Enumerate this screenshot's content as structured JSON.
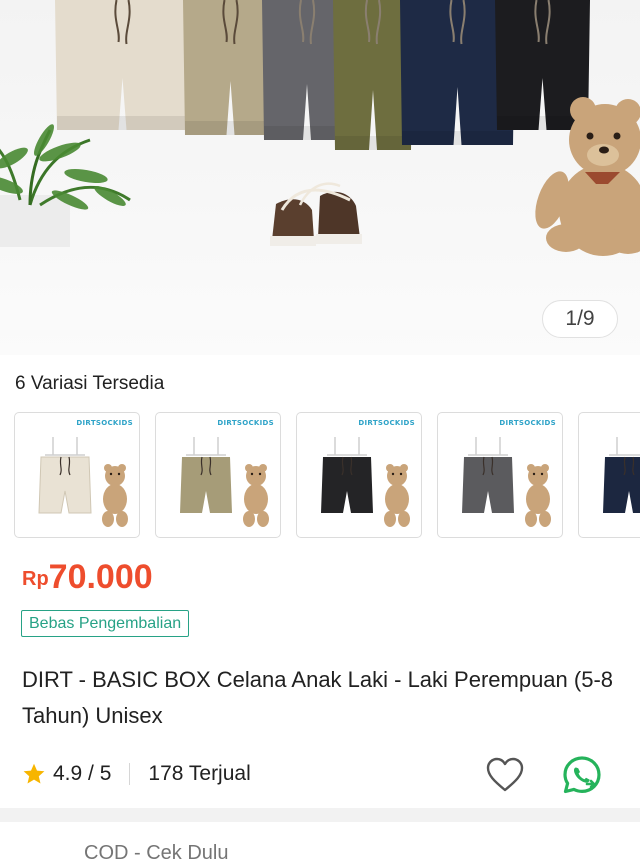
{
  "gallery": {
    "counter": "1/9",
    "colors": {
      "cream": "#e4dccd",
      "khaki": "#b5a98a",
      "charcoal": "#65656a",
      "olive": "#6e6e3f",
      "navy": "#1e2a45",
      "black": "#1c1c1f"
    },
    "decor_icons": [
      "plant-icon",
      "shoes-icon",
      "teddy-bear-icon"
    ]
  },
  "variants": {
    "title": "6 Variasi Tersedia",
    "brand_tag": "DIRTSOCKIDS",
    "items": [
      {
        "color": "#e9e2d4"
      },
      {
        "color": "#a69c78"
      },
      {
        "color": "#242426"
      },
      {
        "color": "#5b5b5e"
      },
      {
        "color": "#1c2740"
      }
    ]
  },
  "product": {
    "currency": "Rp",
    "price": "70.000",
    "badge": "Bebas Pengembalian",
    "title": "DIRT - BASIC BOX Celana Anak Laki - Laki Perempuan (5-8 Tahun) Unisex",
    "rating": "4.9 / 5",
    "sold": "178 Terjual",
    "accent_color": "#ee4d2d",
    "badge_color": "#27a286",
    "whatsapp_color": "#25b35b"
  },
  "peek": {
    "text": "COD - Cek Dulu"
  }
}
